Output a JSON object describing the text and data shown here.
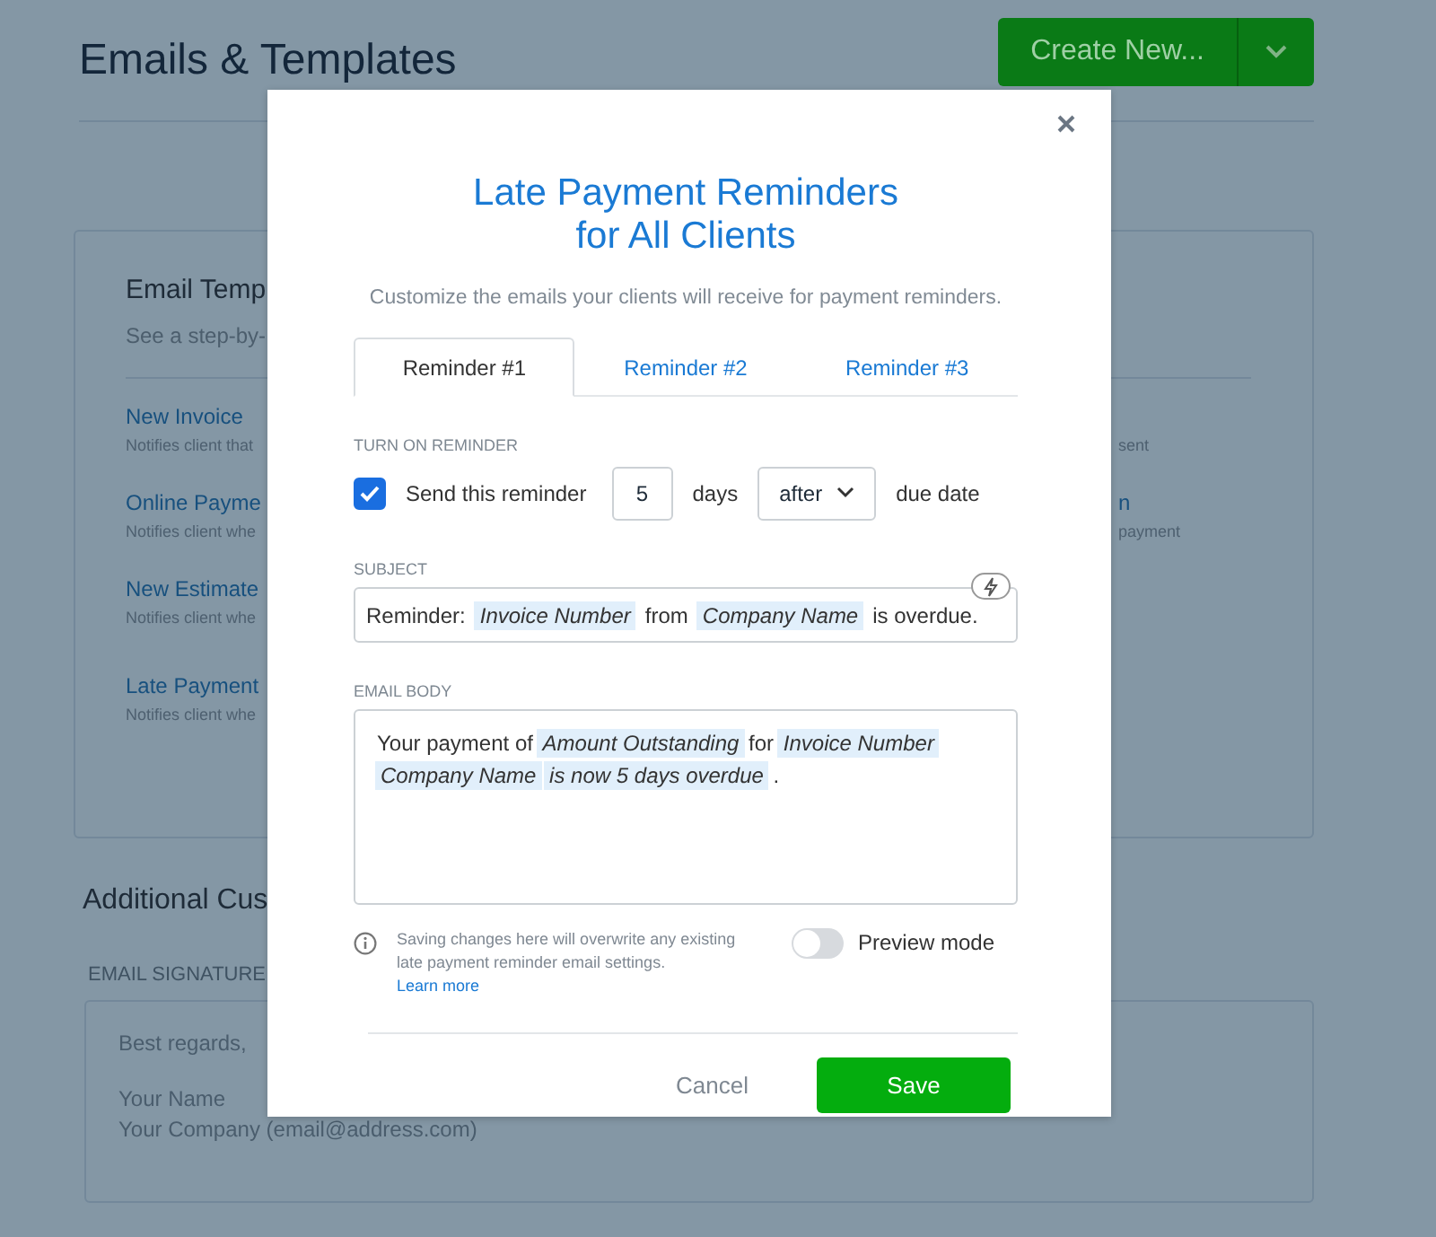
{
  "page": {
    "title": "Emails & Templates",
    "create_button": "Create New...",
    "card": {
      "title": "Email Temp",
      "subtitle": "See a step-by-",
      "items": [
        {
          "title": "New Invoice",
          "description": "Notifies client that",
          "description_tail": "sent"
        },
        {
          "title": "Online Payme",
          "description": "Notifies client whe",
          "title_tail": "n",
          "description_tail": "payment"
        },
        {
          "title": "New Estimate",
          "description": "Notifies client whe"
        },
        {
          "title": "Late Payment",
          "description": "Notifies client whe"
        }
      ]
    },
    "additional_title": "Additional Cus",
    "signature_label": "EMAIL SIGNATURE",
    "signature_lines": [
      "Best regards,",
      "Your Name",
      "Your Company (email@address.com)"
    ]
  },
  "dialog": {
    "title_lines": [
      "Late Payment Reminders",
      "for All Clients"
    ],
    "subtitle": "Customize the emails your clients will receive for payment reminders.",
    "tabs": [
      {
        "label": "Reminder #1",
        "selected": true
      },
      {
        "label": "Reminder #2",
        "selected": false
      },
      {
        "label": "Reminder #3",
        "selected": false
      }
    ],
    "turn_on_label": "TURN ON REMINDER",
    "send_checked": true,
    "send_label": "Send this reminder",
    "days_value": "5",
    "days_label": "days",
    "timing_value": "after",
    "due_label": "due date",
    "subject_label": "SUBJECT",
    "subject": [
      {
        "kind": "text",
        "text": "Reminder:"
      },
      {
        "kind": "token",
        "text": "Invoice Number"
      },
      {
        "kind": "text",
        "text": "from"
      },
      {
        "kind": "token",
        "text": "Company Name"
      },
      {
        "kind": "text",
        "text": "is overdue."
      }
    ],
    "body_label": "EMAIL BODY",
    "body": [
      {
        "kind": "text",
        "text": "Your payment of"
      },
      {
        "kind": "token",
        "text": "Amount Outstanding"
      },
      {
        "kind": "text",
        "text": "for"
      },
      {
        "kind": "token",
        "text": "Invoice Number"
      },
      {
        "kind": "token",
        "text": "Company Name"
      },
      {
        "kind": "token",
        "text": "is now 5 days overdue"
      },
      {
        "kind": "text",
        "text": "."
      }
    ],
    "note": "Saving changes here will overwrite any existing late payment reminder email settings.",
    "learn_more": "Learn more",
    "preview_on": false,
    "preview_label": "Preview mode",
    "cancel": "Cancel",
    "save": "Save"
  }
}
